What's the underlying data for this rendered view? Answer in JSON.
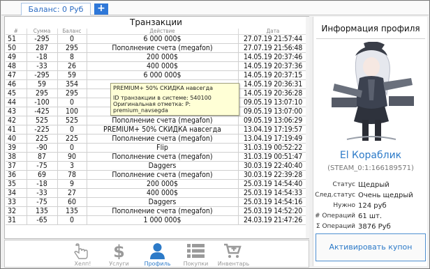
{
  "tabs": {
    "balance_label": "Баланс: 0 Руб",
    "add_label": "+"
  },
  "transactions": {
    "title": "Транзакции",
    "columns": [
      "#",
      "Сумма",
      "Баланс",
      "Действие",
      "Дата"
    ],
    "rows": [
      [
        "51",
        "-295",
        "0",
        "6 000 000$",
        "27.07.19 21:57:44"
      ],
      [
        "50",
        "287",
        "295",
        "Пополнение счета (megafon)",
        "27.07.19 21:56:48"
      ],
      [
        "49",
        "-18",
        "8",
        "200 000$",
        "14.05.19 20:37:46"
      ],
      [
        "48",
        "-33",
        "26",
        "400 000$",
        "14.05.19 20:37:36"
      ],
      [
        "47",
        "-295",
        "59",
        "6 000 000$",
        "14.05.19 20:37:15"
      ],
      [
        "46",
        "59",
        "354",
        "",
        "14.05.19 20:36:31"
      ],
      [
        "45",
        "295",
        "295",
        "",
        "14.05.19 20:36:28"
      ],
      [
        "44",
        "-100",
        "0",
        "Ra",
        "09.05.19 13:07:10"
      ],
      [
        "43",
        "-425",
        "100",
        "USAS навсегда",
        "09.05.19 13:07:00"
      ],
      [
        "42",
        "525",
        "525",
        "Пополнение счета (megafon)",
        "09.05.19 13:06:29"
      ],
      [
        "41",
        "-225",
        "0",
        "PREMIUM+ 50% СКИДКА навсегда",
        "13.04.19 17:19:57"
      ],
      [
        "40",
        "225",
        "225",
        "Пополнение счета (megafon)",
        "13.04.19 17:19:49"
      ],
      [
        "39",
        "-90",
        "0",
        "Flip",
        "31.03.19 00:52:22"
      ],
      [
        "38",
        "87",
        "90",
        "Пополнение счета (megafon)",
        "31.03.19 00:51:47"
      ],
      [
        "37",
        "-75",
        "3",
        "Daggers",
        "30.03.19 22:40:40"
      ],
      [
        "36",
        "69",
        "78",
        "Пополнение счета (megafon)",
        "30.03.19 22:39:28"
      ],
      [
        "35",
        "-18",
        "9",
        "200 000$",
        "25.03.19 14:54:40"
      ],
      [
        "34",
        "-33",
        "27",
        "400 000$",
        "25.03.19 14:54:33"
      ],
      [
        "33",
        "-75",
        "60",
        "Daggers",
        "25.03.19 14:54:16"
      ],
      [
        "32",
        "135",
        "135",
        "Пополнение счета (megafon)",
        "25.03.19 14:52:20"
      ],
      [
        "31",
        "-65",
        "0",
        "1 000 000$",
        "24.03.19 21:47:26"
      ]
    ]
  },
  "tooltip": {
    "line1": "PREMIUM+ 50% СКИДКА навсегда",
    "line2": "ID транзакции в системе: 540100",
    "line3": "Оригинальная отметка: P: premium_navsegda"
  },
  "profile": {
    "title": "Информация профиля",
    "name": "El Кораблик",
    "steam_id": "(STEAM_0:1:166189571)",
    "stats": [
      {
        "label": "Статус",
        "value": "Щедрый"
      },
      {
        "label": "След.статус",
        "value": "Очень щедрый"
      },
      {
        "label": "Нужно",
        "value": "124 руб"
      },
      {
        "label": "# Операций",
        "value": "61 шт."
      },
      {
        "label": "Σ Операций",
        "value": "3876 Руб"
      },
      {
        "label": "1 Операция",
        "value": "22.12.18"
      }
    ],
    "coupon_button": "Активировать купон"
  },
  "nav": {
    "items": [
      {
        "label": "Хелп!",
        "icon": "hand-pointer-icon"
      },
      {
        "label": "Услуги",
        "icon": "dollar-icon"
      },
      {
        "label": "Профиль",
        "icon": "user-icon",
        "active": true
      },
      {
        "label": "Покупки",
        "icon": "list-icon"
      },
      {
        "label": "Инвентарь",
        "icon": "cart-plus-icon"
      }
    ]
  },
  "colors": {
    "accent": "#2c7ac8",
    "tooltip_bg": "#ffffd6",
    "tab_button": "#2f78d8"
  }
}
